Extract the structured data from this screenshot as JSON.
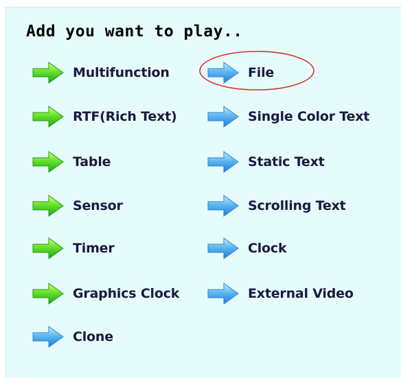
{
  "heading": "Add you want to play..",
  "colors": {
    "panel_bg": "#e6fbfb",
    "green_arrow": "#3cd21e",
    "blue_arrow": "#4aa6ea",
    "highlight": "#d9322c"
  },
  "left_items": [
    {
      "label": "Multifunction",
      "icon": "green-arrow-icon"
    },
    {
      "label": "RTF(Rich Text)",
      "icon": "green-arrow-icon"
    },
    {
      "label": "Table",
      "icon": "green-arrow-icon"
    },
    {
      "label": "Sensor",
      "icon": "green-arrow-icon"
    },
    {
      "label": "Timer",
      "icon": "green-arrow-icon"
    },
    {
      "label": "Graphics Clock",
      "icon": "green-arrow-icon"
    },
    {
      "label": "Clone",
      "icon": "blue-arrow-icon"
    }
  ],
  "right_items": [
    {
      "label": "File",
      "icon": "blue-arrow-icon",
      "highlighted": true
    },
    {
      "label": "Single Color Text",
      "icon": "blue-arrow-icon"
    },
    {
      "label": "Static Text",
      "icon": "blue-arrow-icon"
    },
    {
      "label": "Scrolling Text",
      "icon": "blue-arrow-icon"
    },
    {
      "label": "Clock",
      "icon": "blue-arrow-icon"
    },
    {
      "label": "External Video",
      "icon": "blue-arrow-icon"
    }
  ]
}
